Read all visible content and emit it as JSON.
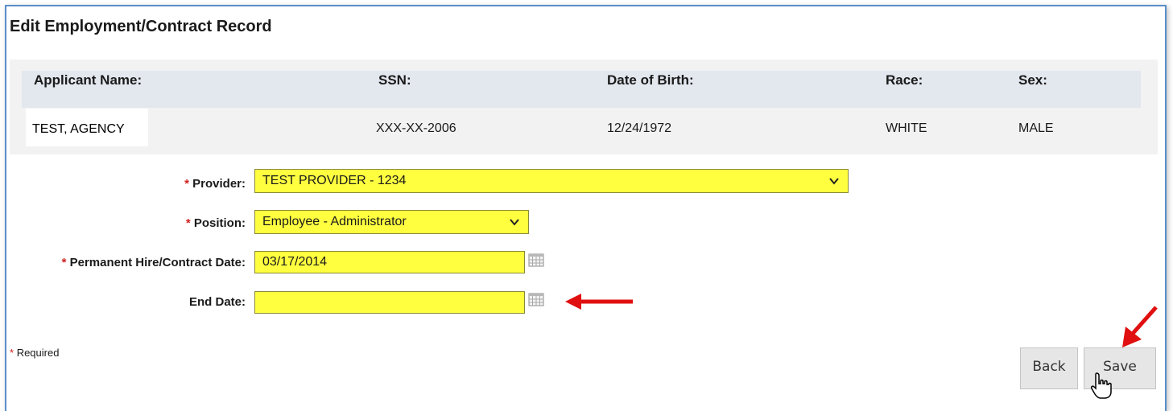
{
  "page": {
    "title": "Edit Employment/Contract Record"
  },
  "applicant": {
    "headers": {
      "name": "Applicant Name:",
      "ssn": "SSN:",
      "dob": "Date of Birth:",
      "race": "Race:",
      "sex": "Sex:"
    },
    "values": {
      "name": "TEST, AGENCY",
      "ssn": "XXX-XX-2006",
      "dob": "12/24/1972",
      "race": "WHITE",
      "sex": "MALE"
    }
  },
  "form": {
    "required_marker": "*",
    "provider": {
      "label": "Provider:",
      "value": "TEST PROVIDER - 1234"
    },
    "position": {
      "label": "Position:",
      "value": "Employee - Administrator"
    },
    "hire_date": {
      "label": "Permanent Hire/Contract Date:",
      "value": "03/17/2014"
    },
    "end_date": {
      "label": "End Date:",
      "value": ""
    },
    "required_note": "Required"
  },
  "buttons": {
    "back": "Back",
    "save": "Save"
  },
  "icons": {
    "provider_dropdown": "chevron-down-icon",
    "position_dropdown": "chevron-down-icon",
    "hire_calendar": "calendar-icon",
    "end_calendar": "calendar-icon",
    "annotation_arrow": "red-arrow-icon",
    "cursor": "hand-pointer-icon"
  },
  "colors": {
    "field_bg": "#ffff40",
    "required": "#d02020",
    "header_bg": "#e3e7ee",
    "frame_border": "#5b8fc9",
    "arrow": "#e01010"
  }
}
